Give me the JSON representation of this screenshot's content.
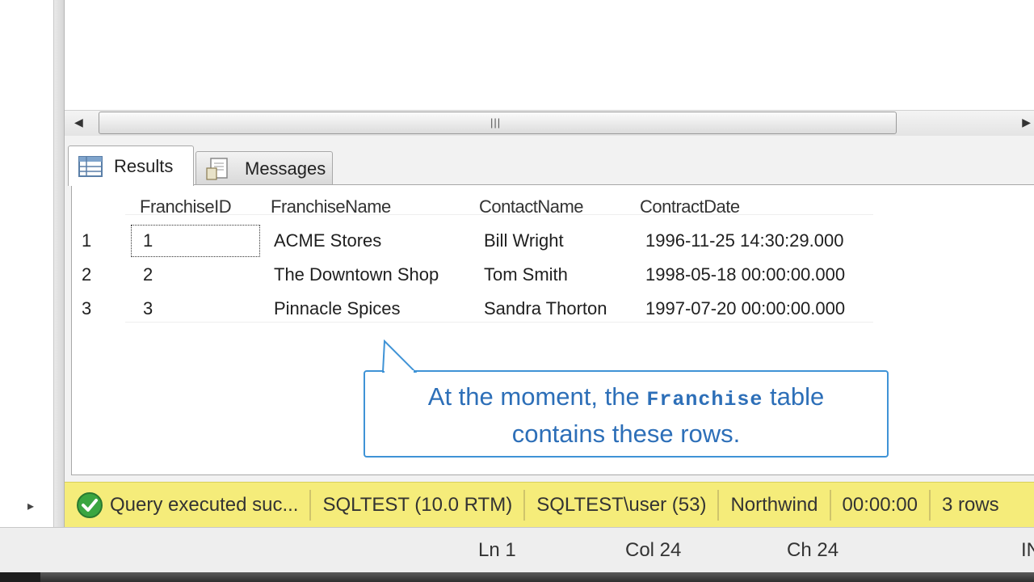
{
  "results": {
    "tabs": [
      {
        "label": "Results",
        "icon": "grid-icon"
      },
      {
        "label": "Messages",
        "icon": "messages-icon"
      }
    ],
    "columns": [
      "FranchiseID",
      "FranchiseName",
      "ContactName",
      "ContractDate"
    ],
    "rows": [
      {
        "num": "1",
        "id": "1",
        "name": "ACME Stores",
        "contact": "Bill Wright",
        "date": "1996-11-25 14:30:29.000"
      },
      {
        "num": "2",
        "id": "2",
        "name": "The Downtown Shop",
        "contact": "Tom Smith",
        "date": "1998-05-18 00:00:00.000"
      },
      {
        "num": "3",
        "id": "3",
        "name": "Pinnacle Spices",
        "contact": "Sandra Thorton",
        "date": "1997-07-20 00:00:00.000"
      }
    ]
  },
  "callout": {
    "line1_before": "At the moment, the",
    "table_name": "Franchise",
    "line1_after": "table",
    "line2": "contains these rows."
  },
  "status": {
    "message": "Query executed suc...",
    "server": "SQLTEST (10.0 RTM)",
    "user": "SQLTEST\\user (53)",
    "database": "Northwind",
    "elapsed": "00:00:00",
    "rows": "3 rows"
  },
  "position": {
    "ln": "Ln 1",
    "col": "Col 24",
    "ch": "Ch 24",
    "mode": "IN"
  },
  "colors": {
    "status_bar": "#f5ec7a",
    "callout_border": "#3f93d6",
    "callout_text": "#2d6fb8"
  }
}
